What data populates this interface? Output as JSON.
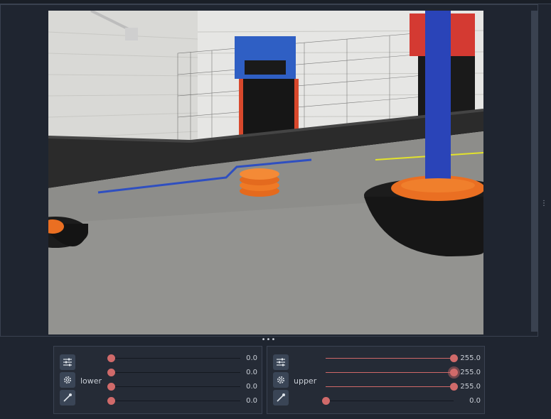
{
  "colors": {
    "accent": "#d06868",
    "panel_bg": "#252b36",
    "window_bg": "#1f2530"
  },
  "lower_panel": {
    "label": "lower",
    "buttons": [
      "sliders-icon",
      "gear-icon",
      "eyedropper-icon"
    ],
    "channels": [
      {
        "value": 0.0,
        "display": "0.0"
      },
      {
        "value": 0.0,
        "display": "0.0"
      },
      {
        "value": 0.0,
        "display": "0.0"
      },
      {
        "value": 0.0,
        "display": "0.0"
      }
    ]
  },
  "upper_panel": {
    "label": "upper",
    "buttons": [
      "sliders-icon",
      "gear-icon",
      "eyedropper-icon"
    ],
    "channels": [
      {
        "value": 255.0,
        "display": "255.0"
      },
      {
        "value": 255.0,
        "display": "255.0"
      },
      {
        "value": 255.0,
        "display": "255.0"
      },
      {
        "value": 0.0,
        "display": "0.0"
      }
    ]
  },
  "slider_max": 255
}
